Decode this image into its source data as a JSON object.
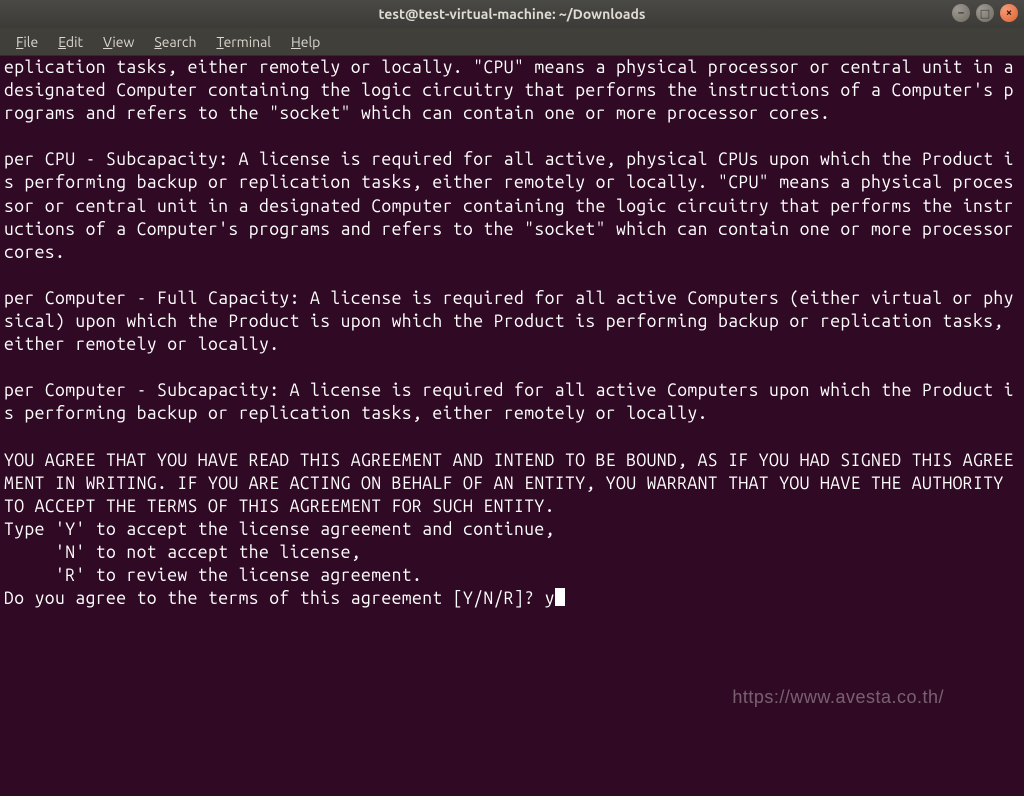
{
  "titlebar": {
    "title": "test@test-virtual-machine: ~/Downloads"
  },
  "window_controls": {
    "minimize_glyph": "–",
    "maximize_glyph": "□",
    "close_glyph": "×"
  },
  "menubar": {
    "file": "File",
    "edit": "Edit",
    "view": "View",
    "search": "Search",
    "terminal": "Terminal",
    "help": "Help"
  },
  "terminal": {
    "body": "eplication tasks, either remotely or locally. \"CPU\" means a physical processor or central unit in a designated Computer containing the logic circuitry that performs the instructions of a Computer's programs and refers to the \"socket\" which can contain one or more processor cores.\n\nper CPU - Subcapacity: A license is required for all active, physical CPUs upon which the Product is performing backup or replication tasks, either remotely or locally. \"CPU\" means a physical processor or central unit in a designated Computer containing the logic circuitry that performs the instructions of a Computer's programs and refers to the \"socket\" which can contain one or more processor cores.\n\nper Computer - Full Capacity: A license is required for all active Computers (either virtual or physical) upon which the Product is upon which the Product is performing backup or replication tasks, either remotely or locally.\n\nper Computer - Subcapacity: A license is required for all active Computers upon which the Product is performing backup or replication tasks, either remotely or locally.\n\nYOU AGREE THAT YOU HAVE READ THIS AGREEMENT AND INTEND TO BE BOUND, AS IF YOU HAD SIGNED THIS AGREEMENT IN WRITING. IF YOU ARE ACTING ON BEHALF OF AN ENTITY, YOU WARRANT THAT YOU HAVE THE AUTHORITY TO ACCEPT THE TERMS OF THIS AGREEMENT FOR SUCH ENTITY.\nType 'Y' to accept the license agreement and continue,\n     'N' to not accept the license,\n     'R' to review the license agreement.\nDo you agree to the terms of this agreement [Y/N/R]? ",
    "input": "y"
  },
  "watermark": "https://www.avesta.co.th/"
}
